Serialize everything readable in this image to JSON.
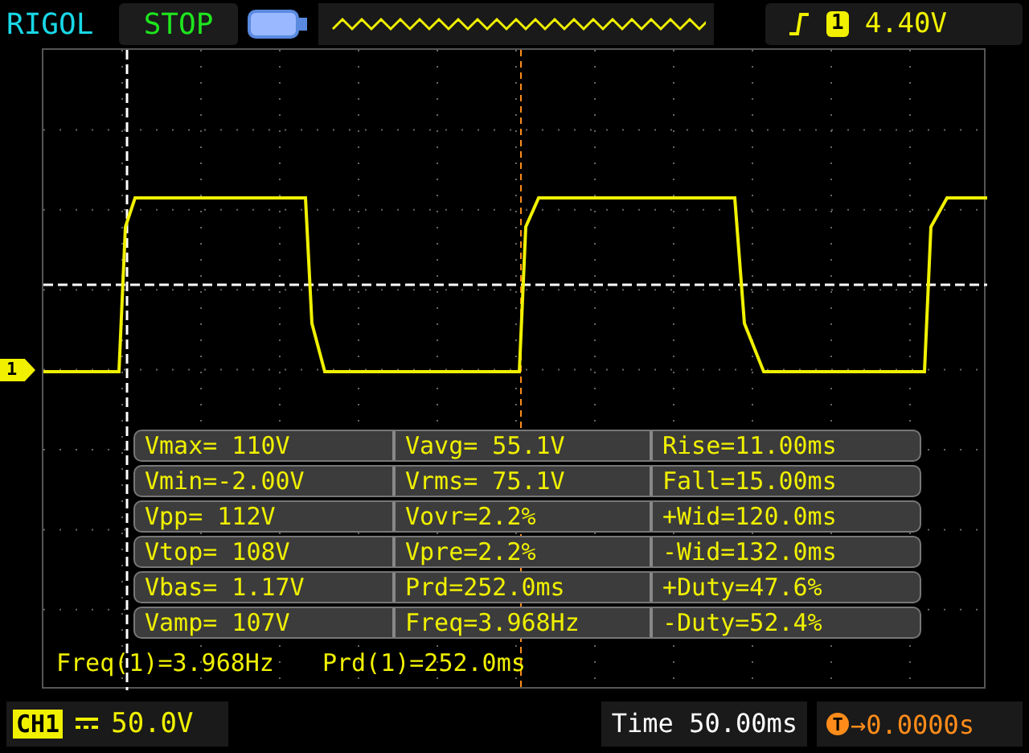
{
  "top_bar": {
    "brand": "RIGOL",
    "run_state": "STOP",
    "trigger": {
      "channel": "1",
      "level": "4.40V"
    }
  },
  "scope": {
    "channel_marker": "1",
    "measurements": [
      [
        "Vmax= 110V",
        "Vavg= 55.1V",
        "Rise=11.00ms"
      ],
      [
        "Vmin=-2.00V",
        "Vrms= 75.1V",
        "Fall=15.00ms"
      ],
      [
        "Vpp= 112V",
        "Vovr=2.2%",
        "+Wid=120.0ms"
      ],
      [
        "Vtop= 108V",
        "Vpre=2.2%",
        "-Wid=132.0ms"
      ],
      [
        "Vbas= 1.17V",
        "Prd=252.0ms",
        "+Duty=47.6%"
      ],
      [
        "Vamp= 107V",
        "Freq=3.968Hz",
        "-Duty=52.4%"
      ]
    ],
    "readouts": [
      "Freq(1)=3.968Hz",
      "Prd(1)=252.0ms"
    ]
  },
  "bottom_bar": {
    "channel": "CH1",
    "scale": "50.0V",
    "timebase": "Time 50.00ms",
    "trigger_badge": "T",
    "trigger_offset": "→0.0000s"
  }
}
